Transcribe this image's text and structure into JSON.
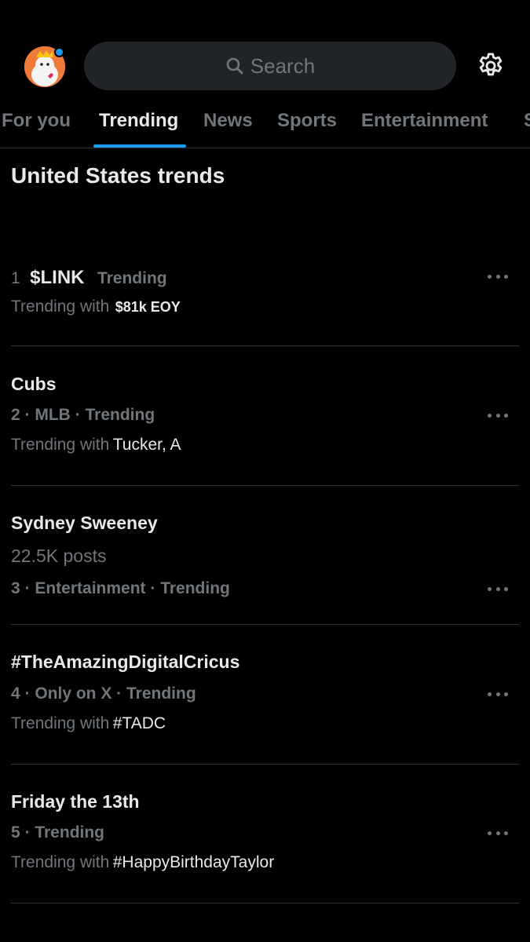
{
  "header": {
    "search_placeholder": "Search",
    "avatar_icon": "avatar-image",
    "settings_icon": "gear-icon"
  },
  "tabs": [
    {
      "label": "For you",
      "active": false
    },
    {
      "label": "Trending",
      "active": true
    },
    {
      "label": "News",
      "active": false
    },
    {
      "label": "Sports",
      "active": false
    },
    {
      "label": "Entertainment",
      "active": false
    },
    {
      "label": "S",
      "active": false
    }
  ],
  "section_title": "United States trends",
  "trends": [
    {
      "rank": "1",
      "name": "$LINK",
      "context": "Trending",
      "with_prefix": "Trending with",
      "with_value": "$81k EOY"
    },
    {
      "name": "Cubs",
      "meta": "2 · MLB · Trending",
      "with_prefix": "Trending with",
      "with_value": "Tucker, A"
    },
    {
      "name": "Sydney Sweeney",
      "posts": "22.5K posts",
      "meta": "3 · Entertainment · Trending"
    },
    {
      "name": "#TheAmazingDigitalCricus",
      "meta": "4 · Only on X · Trending",
      "with_prefix": "Trending with",
      "with_value": "#TADC"
    },
    {
      "name": "Friday the 13th",
      "meta": "5 · Trending",
      "with_prefix": "Trending with",
      "with_value": "#HappyBirthdayTaylor"
    }
  ],
  "colors": {
    "background": "#000000",
    "accent": "#1d9bf0",
    "text_primary": "#e7e9ea",
    "text_secondary": "#71767b",
    "divider": "#2f3336"
  }
}
